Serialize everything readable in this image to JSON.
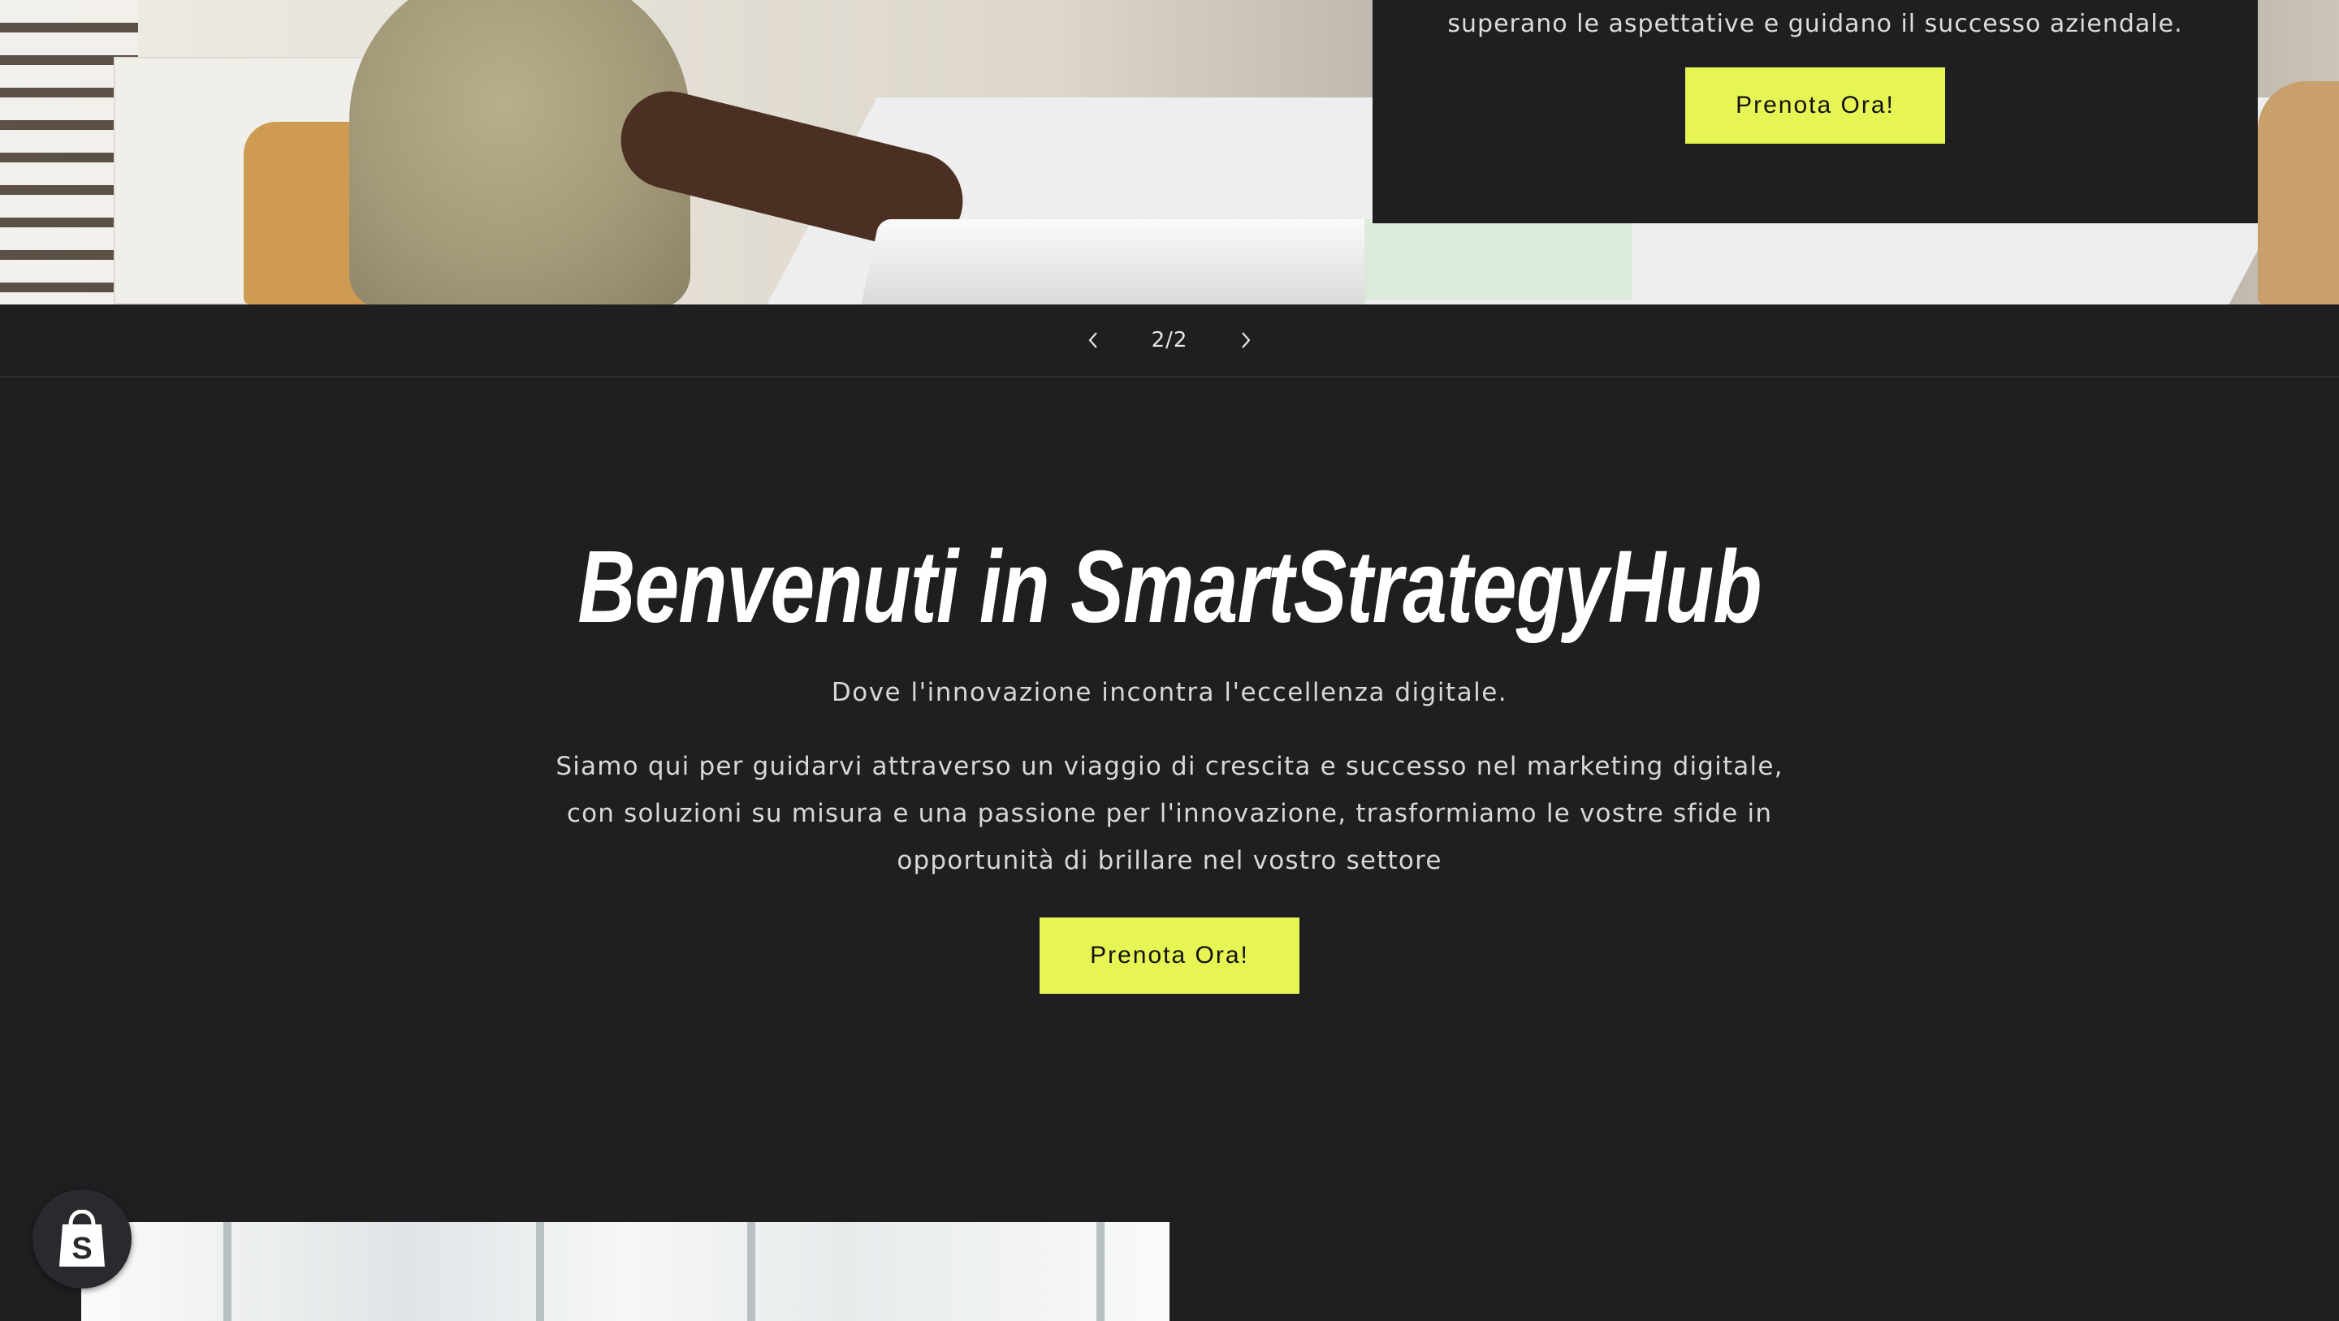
{
  "slideshow": {
    "card_text": "superano le aspettative e guidano il successo aziendale.",
    "card_button_label": "Prenota Ora!",
    "counter": "2/2",
    "prev_icon": "chevron-left-icon",
    "next_icon": "chevron-right-icon"
  },
  "welcome": {
    "title": "Benvenuti in SmartStrategyHub",
    "subtitle": "Dove l'innovazione incontra l'eccellenza digitale.",
    "body": "Siamo qui per guidarvi attraverso un viaggio di crescita e successo nel marketing digitale, con soluzioni su misura e una passione per l'innovazione, trasformiamo le vostre sfide in opportunità di brillare nel vostro settore",
    "button_label": "Prenota Ora!"
  },
  "badge": {
    "icon": "shopify-bag-icon"
  },
  "colors": {
    "background": "#1f1f22",
    "accent": "#e6f553",
    "text": "#e6e6e6"
  }
}
